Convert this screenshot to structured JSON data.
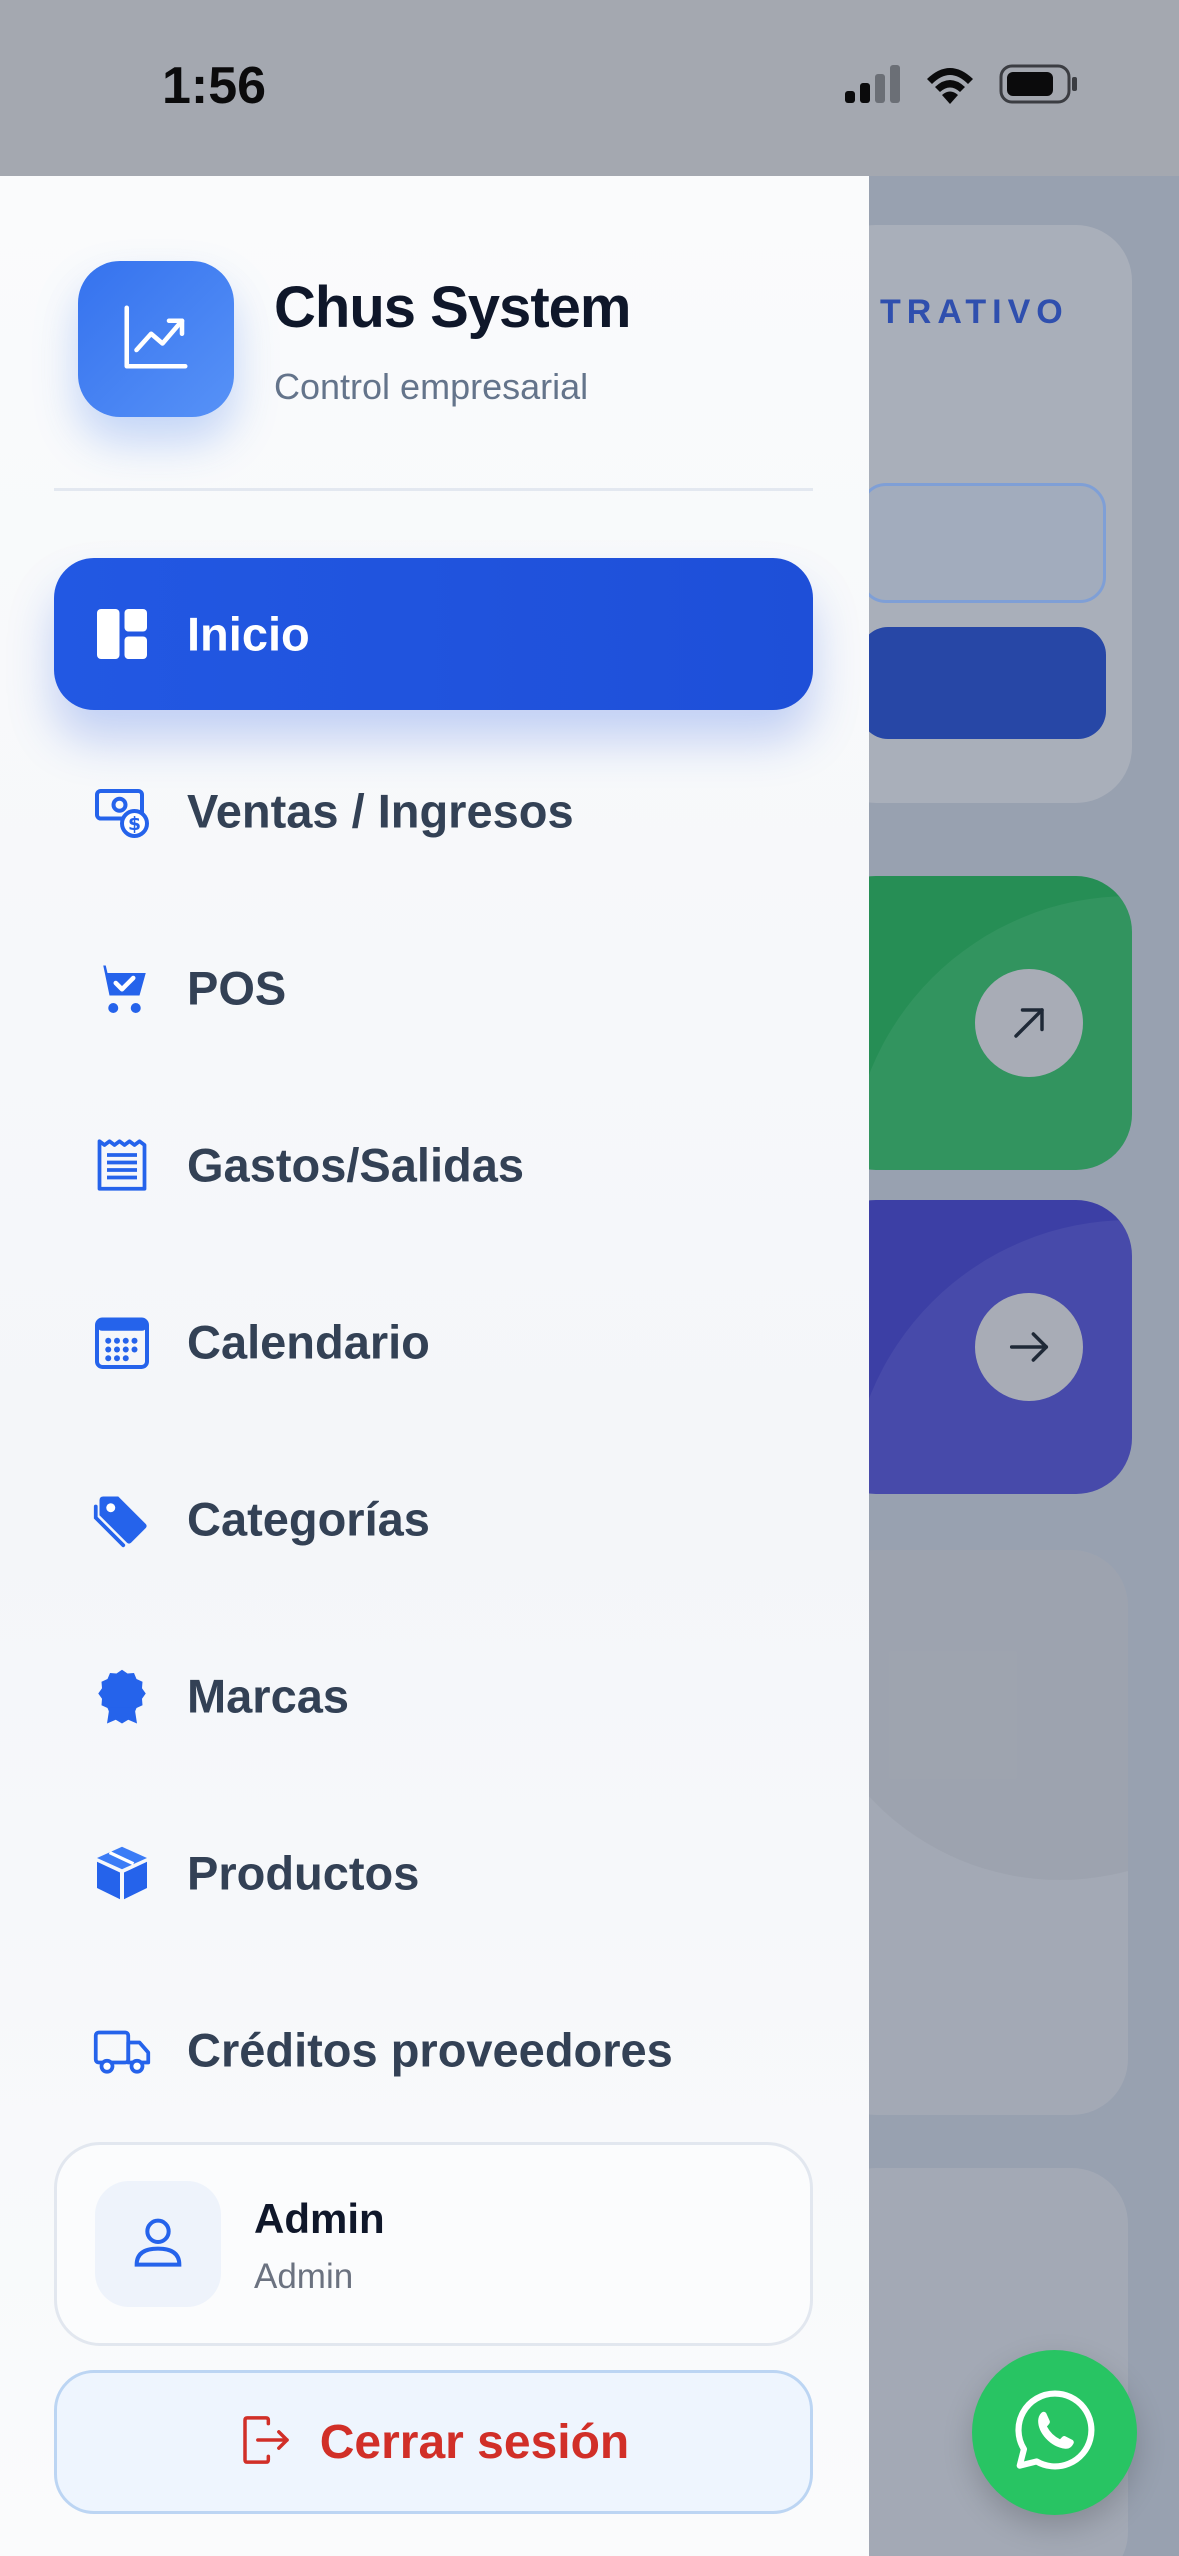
{
  "status_bar": {
    "time": "1:56",
    "icons": [
      "cellular-signal-icon",
      "wifi-icon",
      "battery-icon"
    ]
  },
  "background": {
    "admin_card_label": "TRATIVO"
  },
  "drawer": {
    "brand": {
      "title": "Chus System",
      "subtitle": "Control empresarial",
      "icon": "trend-chart-icon"
    },
    "nav_items": [
      {
        "label": "Inicio",
        "icon": "dashboard-icon",
        "active": true
      },
      {
        "label": "Ventas / Ingresos",
        "icon": "money-icon",
        "active": false
      },
      {
        "label": "POS",
        "icon": "cart-check-icon",
        "active": false
      },
      {
        "label": "Gastos/Salidas",
        "icon": "receipt-icon",
        "active": false
      },
      {
        "label": "Calendario",
        "icon": "calendar-icon",
        "active": false
      },
      {
        "label": "Categorías",
        "icon": "tag-icon",
        "active": false
      },
      {
        "label": "Marcas",
        "icon": "badge-icon",
        "active": false
      },
      {
        "label": "Productos",
        "icon": "box-icon",
        "active": false
      },
      {
        "label": "Créditos proveedores",
        "icon": "truck-icon",
        "active": false
      }
    ],
    "user": {
      "name": "Admin",
      "role": "Admin",
      "icon": "user-icon"
    },
    "logout": {
      "label": "Cerrar sesión",
      "icon": "logout-icon"
    }
  },
  "colors": {
    "primary": "#2258e3",
    "icon_blue": "#2563eb",
    "danger": "#d12f28",
    "whatsapp": "#28c463"
  }
}
